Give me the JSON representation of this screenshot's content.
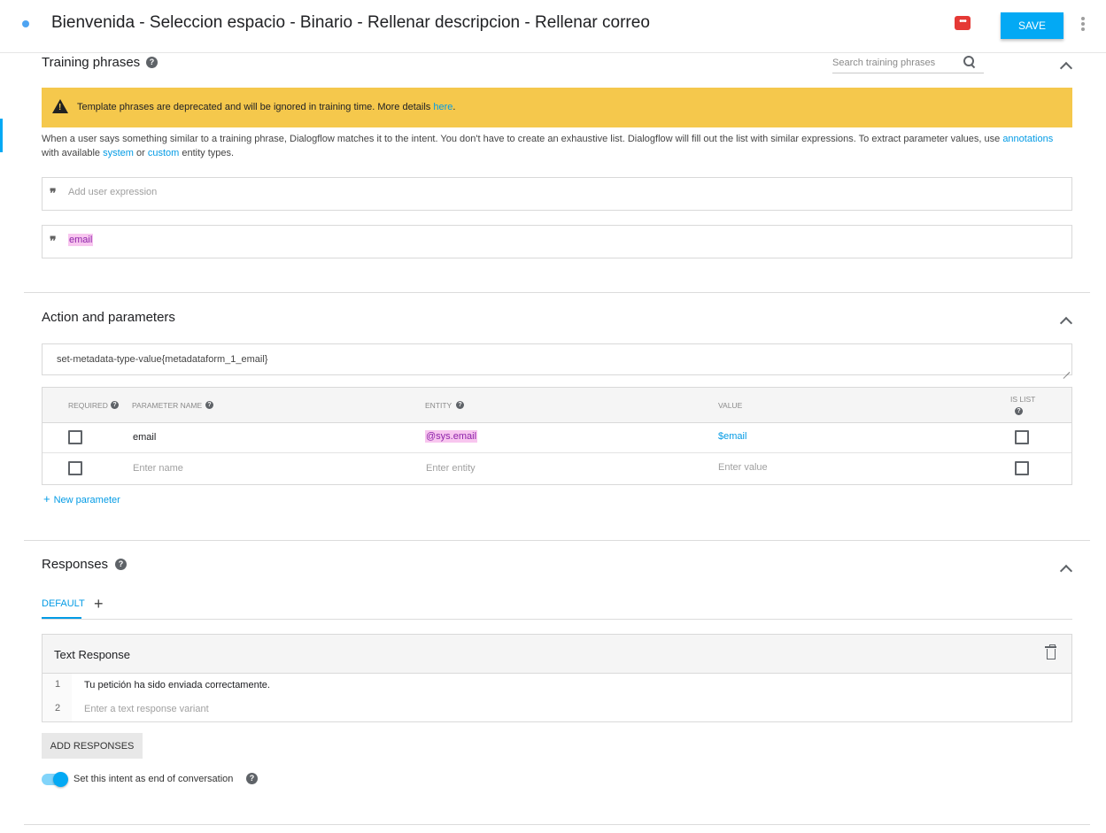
{
  "header": {
    "title": "Bienvenida - Seleccion espacio - Binario - Rellenar descripcion - Rellenar correo",
    "save_label": "SAVE"
  },
  "training": {
    "title": "Training phrases",
    "search_placeholder": "Search training phrases",
    "warning_text": "Template phrases are deprecated and will be ignored in training time. More details ",
    "warning_link": "here",
    "warning_end": ".",
    "desc_part1": "When a user says something similar to a training phrase, Dialogflow matches it to the intent. You don't have to create an exhaustive list. Dialogflow will fill out the list with similar expressions. To extract parameter values, use ",
    "desc_link_annotations": "annotations",
    "desc_part2": " with available ",
    "desc_link_system": "system",
    "desc_part3": " or ",
    "desc_link_custom": "custom",
    "desc_part4": " entity types.",
    "add_placeholder": "Add user expression",
    "phrases": [
      "email"
    ]
  },
  "action": {
    "title": "Action and parameters",
    "action_value": "set-metadata-type-value{metadataform_1_email}",
    "columns": {
      "required": "REQUIRED",
      "parameter_name": "PARAMETER NAME",
      "entity": "ENTITY",
      "value": "VALUE",
      "is_list": "IS LIST"
    },
    "rows": [
      {
        "name": "email",
        "entity": "@sys.email",
        "value": "$email"
      }
    ],
    "placeholders": {
      "name": "Enter name",
      "entity": "Enter entity",
      "value": "Enter value"
    },
    "new_parameter": "New parameter"
  },
  "responses": {
    "title": "Responses",
    "tab_default": "DEFAULT",
    "card_title": "Text Response",
    "lines": [
      {
        "num": "1",
        "text": "Tu petición ha sido enviada correctamente."
      },
      {
        "num": "2",
        "placeholder": "Enter a text response variant"
      }
    ],
    "add_button": "ADD RESPONSES",
    "end_conversation_label": "Set this intent as end of conversation"
  }
}
